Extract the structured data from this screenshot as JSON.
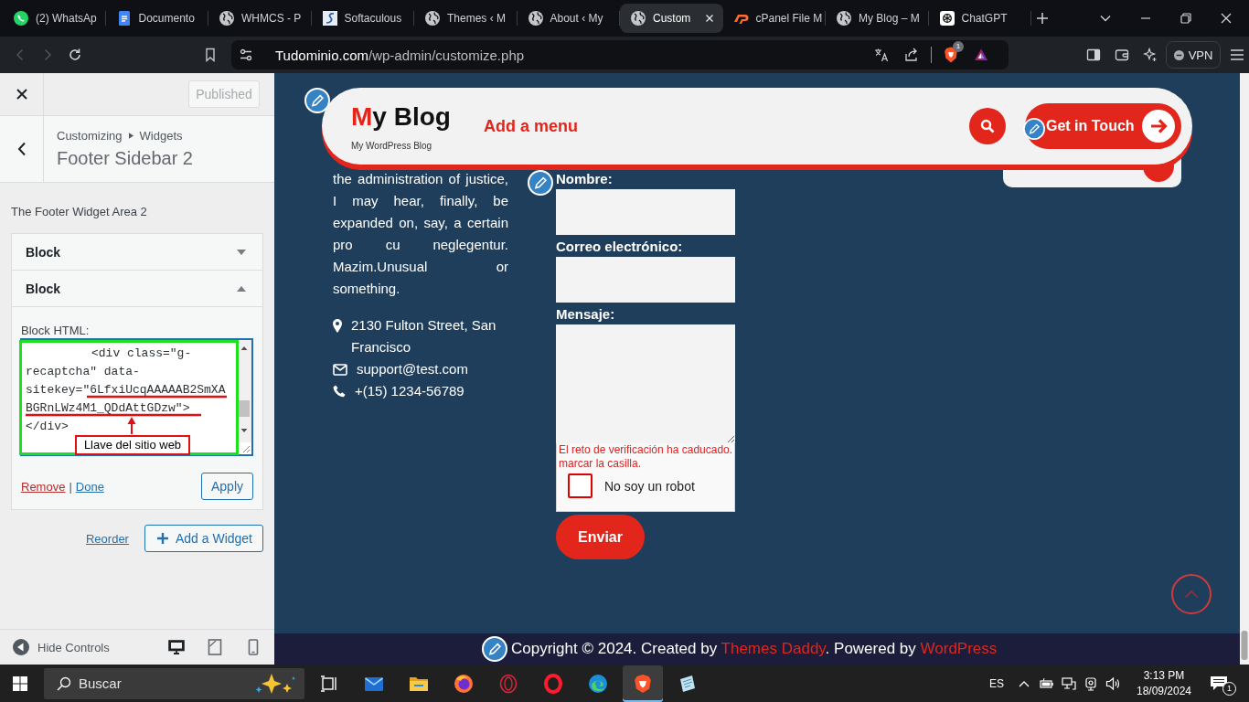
{
  "browser": {
    "tabs": [
      {
        "title": "(2) WhatsAp",
        "kind": "whatsapp",
        "selected": false
      },
      {
        "title": "Documento",
        "kind": "docs",
        "selected": false
      },
      {
        "title": "WHMCS - P",
        "kind": "globe",
        "selected": false
      },
      {
        "title": "Softaculous",
        "kind": "softaculous",
        "selected": false
      },
      {
        "title": "Themes ‹ M",
        "kind": "globe",
        "selected": false
      },
      {
        "title": "About ‹ My",
        "kind": "globe",
        "selected": false
      },
      {
        "title": "Custom",
        "kind": "globe",
        "selected": true
      },
      {
        "title": "cPanel File M",
        "kind": "cpanel",
        "selected": false
      },
      {
        "title": "My Blog – M",
        "kind": "globe",
        "selected": false
      },
      {
        "title": "ChatGPT",
        "kind": "chatgpt",
        "selected": false
      }
    ],
    "nav": {
      "back_disabled": true,
      "forward_disabled": true
    },
    "address": {
      "host": "Tudominio.com",
      "path": "/wp-admin/customize.php"
    },
    "shields_badge": "1",
    "vpn": {
      "label": "VPN",
      "on": false
    }
  },
  "customizer": {
    "published": {
      "label": "Published",
      "disabled": true
    },
    "breadcrumb": {
      "root": "Customizing",
      "current": "Widgets"
    },
    "section_title": "Footer Sidebar 2",
    "description": "The Footer Widget Area 2",
    "widgets": [
      {
        "title": "Block",
        "expanded": false
      },
      {
        "title": "Block",
        "expanded": true,
        "editor": {
          "label": "Block HTML:",
          "code_lines": [
            "<div class=\"g-",
            "recaptcha\" data-",
            "sitekey=\"6LfxiUcqAAAAAB2SmXA",
            "BGRnLWz4M1_QDdAttGDzw\">",
            "</div>"
          ],
          "callout": "Llave del sitio web"
        },
        "actions": {
          "remove": "Remove",
          "separator": "|",
          "done": "Done",
          "apply": "Apply"
        }
      }
    ],
    "reorder": "Reorder",
    "add_widget": "Add a Widget",
    "hide_controls": "Hide Controls",
    "devices": [
      {
        "kind": "desktop",
        "selected": true
      },
      {
        "kind": "tablet",
        "selected": false
      },
      {
        "kind": "mobile",
        "selected": false
      }
    ]
  },
  "preview": {
    "header": {
      "title_accent": "M",
      "title_rest": "y Blog",
      "tagline": "My WordPress Blog",
      "menu_link": "Add a menu",
      "cta": "Get in Touch"
    },
    "about": "the administration of justice, I may hear, finally, be expanded on, say, a certain pro cu neglegentur. Mazim.Unusual or something.",
    "contacts": [
      {
        "kind": "address",
        "text": "2130 Fulton Street, San Francisco"
      },
      {
        "kind": "email",
        "text": "support@test.com"
      },
      {
        "kind": "phone",
        "text": "+(15) 1234-56789"
      }
    ],
    "form": {
      "fields": [
        {
          "label": "Nombre:",
          "kind": "input"
        },
        {
          "label": "Correo electrónico:",
          "kind": "input"
        },
        {
          "label": "Mensaje:",
          "kind": "textarea"
        }
      ],
      "captcha": {
        "error_lines": [
          "El reto de verificación ha caducado.",
          "marcar la casilla."
        ],
        "label": "No soy un robot",
        "checked": false
      },
      "submit": "Enviar"
    },
    "footer": [
      {
        "kind": "text",
        "text": "Copyright © 2024. Created by "
      },
      {
        "kind": "link",
        "text": "Themes Daddy"
      },
      {
        "kind": "text",
        "text": ". Powered by "
      },
      {
        "kind": "link",
        "text": "WordPress"
      }
    ]
  },
  "taskbar": {
    "search_placeholder": "Buscar",
    "apps": [
      {
        "kind": "task-view",
        "selected": false
      },
      {
        "kind": "mail",
        "selected": false
      },
      {
        "kind": "explorer",
        "selected": false
      },
      {
        "kind": "firefox",
        "selected": false
      },
      {
        "kind": "opera-gx",
        "selected": false
      },
      {
        "kind": "opera",
        "selected": false
      },
      {
        "kind": "edge",
        "selected": false
      },
      {
        "kind": "brave",
        "selected": true
      },
      {
        "kind": "notes",
        "selected": false
      }
    ],
    "language": "ES",
    "time": "3:13 PM",
    "date": "18/09/2024",
    "notifications": "1"
  }
}
